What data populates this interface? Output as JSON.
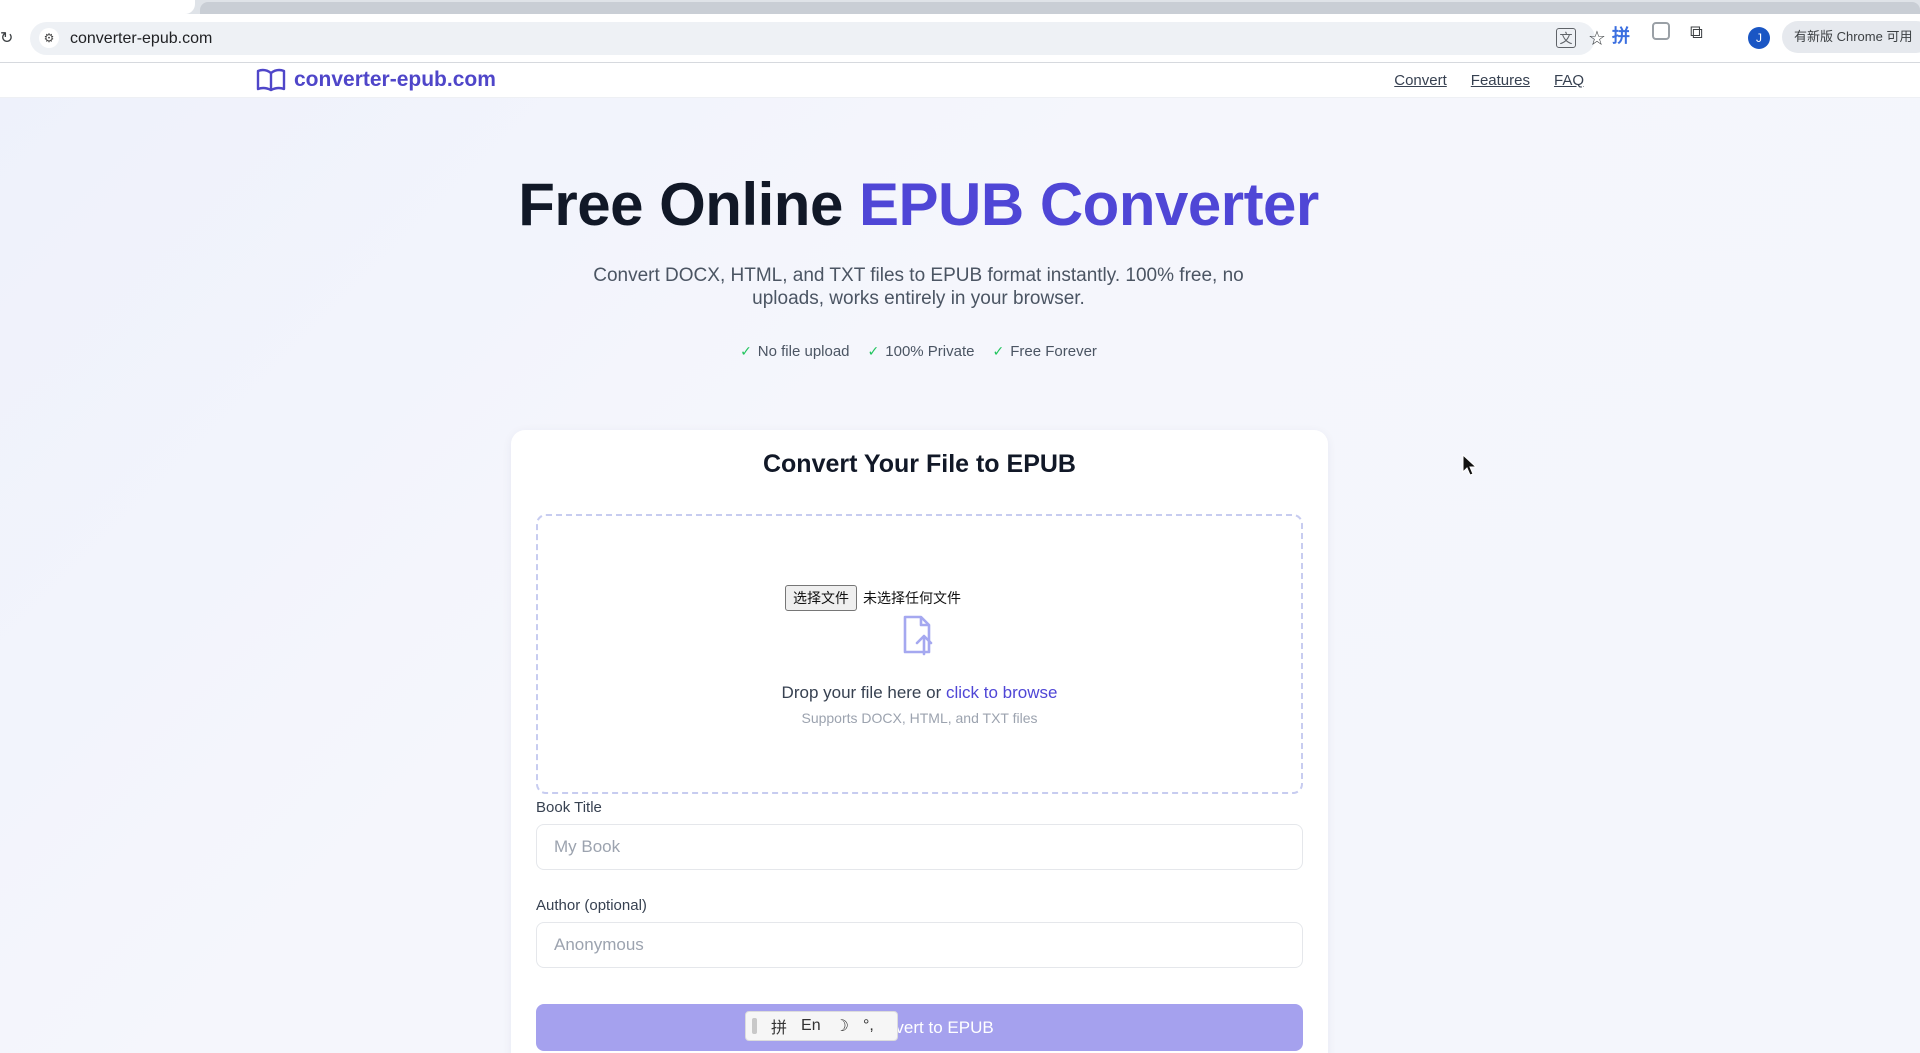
{
  "browser": {
    "url": "converter-epub.com",
    "avatar_initial": "J",
    "update_chip": "有新版 Chrome 可用",
    "pinyin_ext_glyph": "拼"
  },
  "nav": {
    "logo_text": "converter-epub.com",
    "links": [
      "Convert",
      "Features",
      "FAQ"
    ]
  },
  "hero": {
    "title_plain": "Free Online ",
    "title_accent": "EPUB Converter",
    "subtitle": "Convert DOCX, HTML, and TXT files to EPUB format instantly. 100% free, no uploads, works entirely in your browser.",
    "badges": [
      "No file upload",
      "100% Private",
      "Free Forever"
    ]
  },
  "card": {
    "title": "Convert Your File to EPUB",
    "file_button": "选择文件",
    "file_status": "未选择任何文件",
    "drop_text": "Drop your file here or ",
    "drop_link": "click to browse",
    "drop_hint": "Supports DOCX, HTML, and TXT files",
    "title_label": "Book Title",
    "title_placeholder": "My Book",
    "author_label": "Author (optional)",
    "author_placeholder": "Anonymous",
    "convert_button": "Convert to EPUB"
  },
  "ime": {
    "items": [
      "拼",
      "En",
      "☽",
      "°,"
    ]
  },
  "colors": {
    "accent": "#4f46d6",
    "check": "#22c55e",
    "button_disabled": "#a5a1ee"
  }
}
